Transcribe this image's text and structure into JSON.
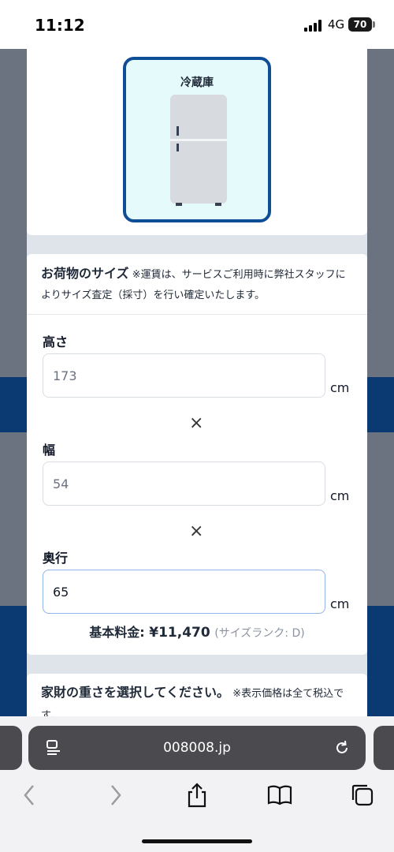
{
  "status_bar": {
    "time": "11:12",
    "network": "4G",
    "battery": "70"
  },
  "fridge_card": {
    "label": "冷蔵庫"
  },
  "size_section": {
    "title": "お荷物のサイズ",
    "note": "※運賃は、サービスご利用時に弊社スタッフによりサイズ査定（採寸）を行い確定いたします。",
    "times_symbol": "×",
    "fields": [
      {
        "label": "高さ",
        "value": "173",
        "unit": "cm"
      },
      {
        "label": "幅",
        "value": "54",
        "unit": "cm"
      },
      {
        "label": "奥行",
        "value": "65",
        "unit": "cm"
      }
    ],
    "price_label": "基本料金:",
    "price_value": "¥11,470",
    "size_rank": "(サイズランク: D)"
  },
  "weight_section": {
    "title": "家財の重さを選択してください。",
    "note": "※表示価格は全て税込です。"
  },
  "browser": {
    "url": "008008.jp",
    "reader_icon": "reader-icon",
    "reload_icon": "reload-icon",
    "toolbar": [
      "back-icon",
      "forward-icon",
      "share-icon",
      "bookmarks-icon",
      "tabs-icon"
    ]
  },
  "colors": {
    "accent": "#0e4e96",
    "navy_band": "#0b3a73",
    "fridge_bg": "#e5fbfb"
  }
}
